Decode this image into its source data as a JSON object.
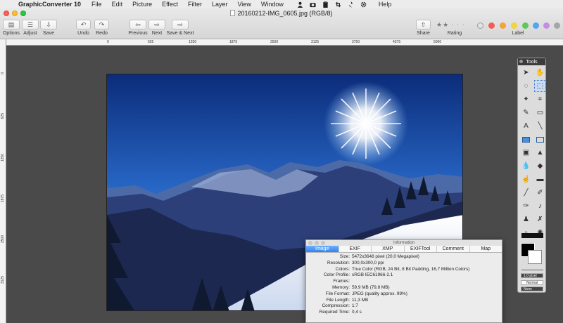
{
  "menubar": {
    "app_name": "GraphicConverter 10",
    "items": [
      "File",
      "Edit",
      "Picture",
      "Effect",
      "Filter",
      "Layer",
      "View",
      "Window",
      "Help"
    ]
  },
  "window": {
    "title": "20160212-IMG_0605.jpg (RGB/8)"
  },
  "toolbar": {
    "options_label": "Options",
    "adjust_label": "Adjust",
    "save_label": "Save",
    "undo_label": "Undo",
    "redo_label": "Redo",
    "previous_label": "Previous",
    "next_label": "Next",
    "save_next_label": "Save & Next",
    "share_label": "Share",
    "rating_label": "Rating",
    "label_label": "Label",
    "rating_stars": "★★ · · ·",
    "label_colors": [
      "#f15c55",
      "#f5a33a",
      "#f2d43c",
      "#5dc85b",
      "#53a4f4",
      "#c48de6",
      "#a6a6a6"
    ]
  },
  "rulers": {
    "horizontal": [
      "0",
      "625",
      "1250",
      "1875",
      "2500",
      "3125",
      "3750",
      "4375",
      "5000"
    ],
    "vertical": [
      "0",
      "625",
      "1250",
      "1875",
      "2500",
      "3125"
    ]
  },
  "tools_panel": {
    "title": "Tools",
    "pen_size": "1.0 pixel",
    "mode": "Normal",
    "blend": "None"
  },
  "info_panel": {
    "title": "Information",
    "tabs": [
      "Image",
      "EXIF",
      "XMP",
      "EXIFTool",
      "Comment",
      "Map"
    ],
    "active_tab": "Image",
    "rows": [
      {
        "key": "Size:",
        "value": "5472x3648 pixel (20,0 Megapixel)"
      },
      {
        "key": "Resolution:",
        "value": "300,0x300,0 ppi"
      },
      {
        "key": "Colors:",
        "value": "True Color (RGB, 24 Bit, 8 Bit Padding, 16,7 Million Colors)"
      },
      {
        "key": "Color Profile:",
        "value": "sRGB IEC61966-2.1"
      },
      {
        "key": "Frames:",
        "value": ""
      },
      {
        "key": "Memory:",
        "value": "59,9 MB (79,8 MB)"
      },
      {
        "key": "File Format:",
        "value": "JPEG (quality approx. 99%)"
      },
      {
        "key": "File Length:",
        "value": "11,3 MB"
      },
      {
        "key": "Compression:",
        "value": "1:7"
      },
      {
        "key": "Required Time:",
        "value": "0,4 s"
      }
    ]
  }
}
